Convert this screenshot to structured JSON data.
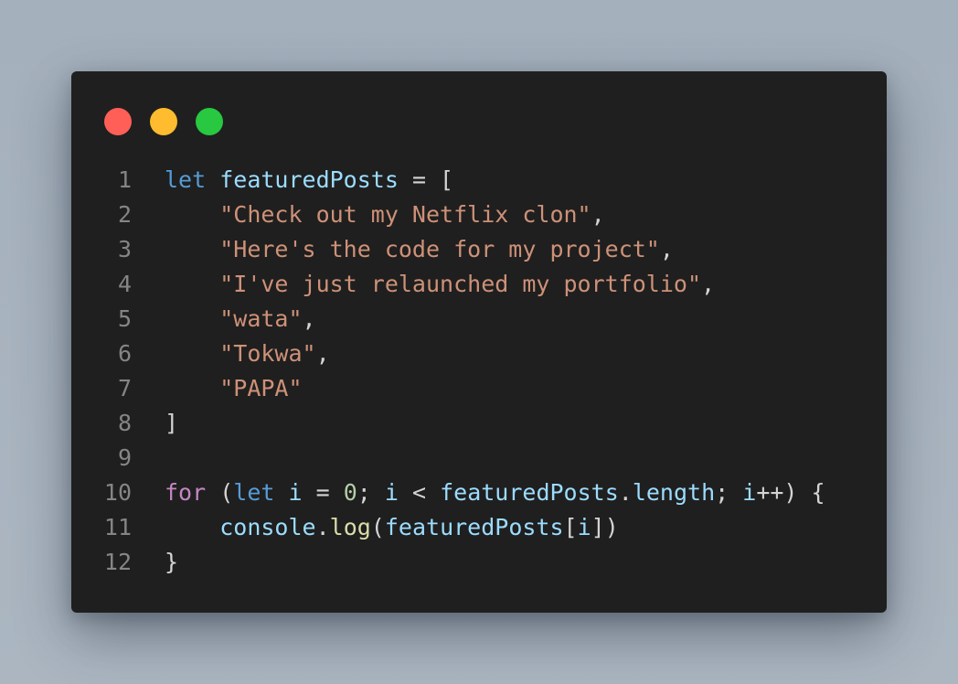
{
  "window": {
    "controls": [
      {
        "name": "close",
        "color": "#ff5f57"
      },
      {
        "name": "minimize",
        "color": "#febc2e"
      },
      {
        "name": "maximize",
        "color": "#28c840"
      }
    ]
  },
  "code": {
    "lines": [
      {
        "n": "1",
        "tokens": [
          [
            "let",
            "kw"
          ],
          [
            " ",
            "pun"
          ],
          [
            "featuredPosts",
            "var"
          ],
          [
            " = [",
            "pun"
          ]
        ]
      },
      {
        "n": "2",
        "tokens": [
          [
            "    ",
            "pun"
          ],
          [
            "\"Check out my Netflix clon\"",
            "str"
          ],
          [
            ",",
            "pun"
          ]
        ]
      },
      {
        "n": "3",
        "tokens": [
          [
            "    ",
            "pun"
          ],
          [
            "\"Here's the code for my project\"",
            "str"
          ],
          [
            ",",
            "pun"
          ]
        ]
      },
      {
        "n": "4",
        "tokens": [
          [
            "    ",
            "pun"
          ],
          [
            "\"I've just relaunched my portfolio\"",
            "str"
          ],
          [
            ",",
            "pun"
          ]
        ]
      },
      {
        "n": "5",
        "tokens": [
          [
            "    ",
            "pun"
          ],
          [
            "\"wata\"",
            "str"
          ],
          [
            ",",
            "pun"
          ]
        ]
      },
      {
        "n": "6",
        "tokens": [
          [
            "    ",
            "pun"
          ],
          [
            "\"Tokwa\"",
            "str"
          ],
          [
            ",",
            "pun"
          ]
        ]
      },
      {
        "n": "7",
        "tokens": [
          [
            "    ",
            "pun"
          ],
          [
            "\"PAPA\"",
            "str"
          ]
        ]
      },
      {
        "n": "8",
        "tokens": [
          [
            "]",
            "pun"
          ]
        ]
      },
      {
        "n": "9",
        "tokens": []
      },
      {
        "n": "10",
        "tokens": [
          [
            "for",
            "ctl"
          ],
          [
            " (",
            "pun"
          ],
          [
            "let",
            "kw"
          ],
          [
            " ",
            "pun"
          ],
          [
            "i",
            "var"
          ],
          [
            " = ",
            "pun"
          ],
          [
            "0",
            "num"
          ],
          [
            "; ",
            "pun"
          ],
          [
            "i",
            "var"
          ],
          [
            " < ",
            "pun"
          ],
          [
            "featuredPosts",
            "var"
          ],
          [
            ".",
            "pun"
          ],
          [
            "length",
            "var"
          ],
          [
            "; ",
            "pun"
          ],
          [
            "i",
            "var"
          ],
          [
            "++) {",
            "pun"
          ]
        ]
      },
      {
        "n": "11",
        "tokens": [
          [
            "    ",
            "pun"
          ],
          [
            "console",
            "var"
          ],
          [
            ".",
            "pun"
          ],
          [
            "log",
            "fn"
          ],
          [
            "(",
            "pun"
          ],
          [
            "featuredPosts",
            "var"
          ],
          [
            "[",
            "pun"
          ],
          [
            "i",
            "var"
          ],
          [
            "])",
            "pun"
          ]
        ]
      },
      {
        "n": "12",
        "tokens": [
          [
            "}",
            "pun"
          ]
        ]
      }
    ]
  }
}
